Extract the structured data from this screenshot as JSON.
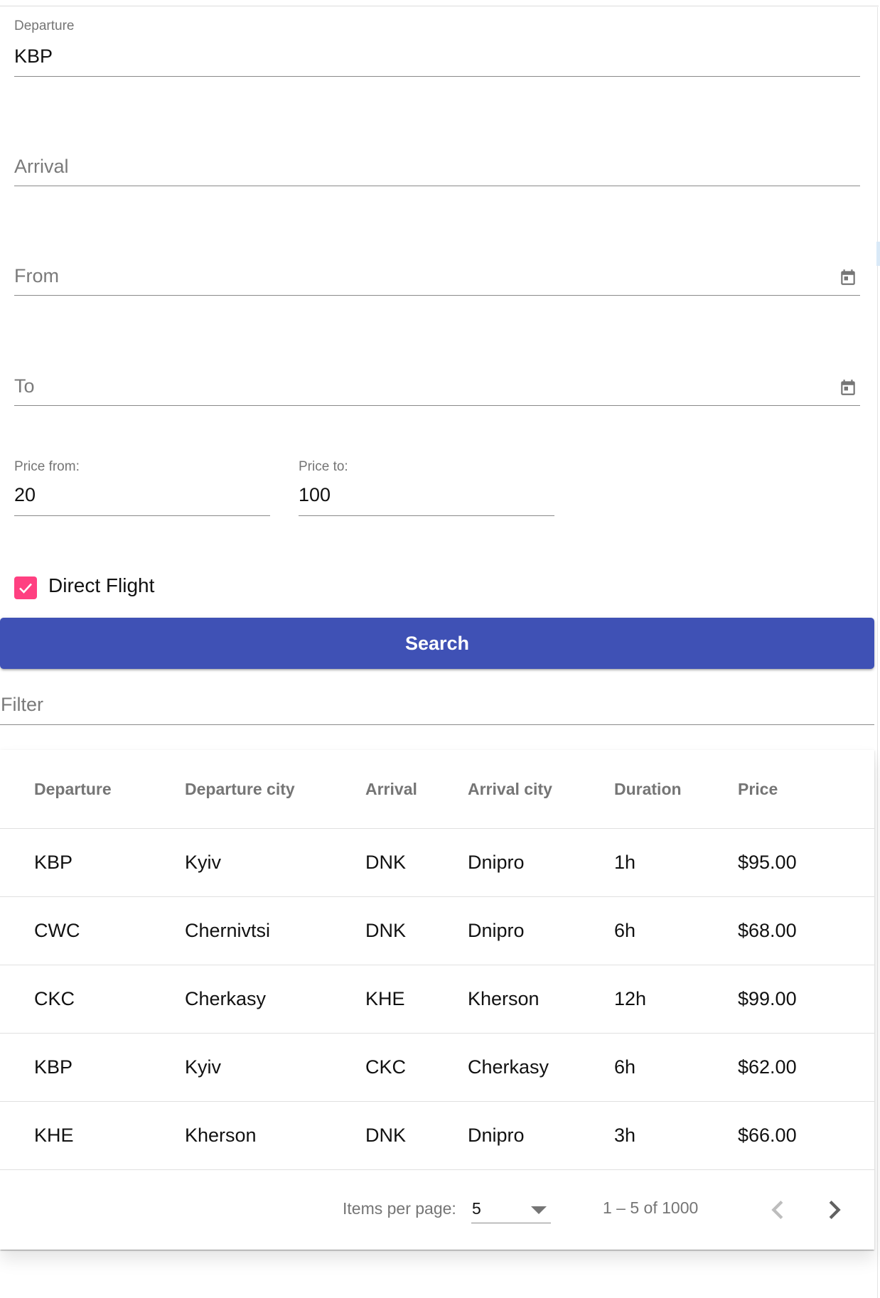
{
  "form": {
    "departure": {
      "label": "Departure",
      "value": "KBP"
    },
    "arrival": {
      "placeholder": "Arrival"
    },
    "from_date": {
      "placeholder": "From",
      "icon": "calendar-icon"
    },
    "to_date": {
      "placeholder": "To",
      "icon": "calendar-icon"
    },
    "price_from": {
      "label": "Price from:",
      "value": "20"
    },
    "price_to": {
      "label": "Price to:",
      "value": "100"
    },
    "direct_flight": {
      "label": "Direct Flight",
      "checked": true
    },
    "search_button": {
      "label": "Search"
    },
    "filter": {
      "placeholder": "Filter"
    }
  },
  "table": {
    "columns": [
      "Departure",
      "Departure city",
      "Arrival",
      "Arrival city",
      "Duration",
      "Price"
    ],
    "rows": [
      [
        "KBP",
        "Kyiv",
        "DNK",
        "Dnipro",
        "1h",
        "$95.00"
      ],
      [
        "CWC",
        "Chernivtsi",
        "DNK",
        "Dnipro",
        "6h",
        "$68.00"
      ],
      [
        "CKC",
        "Cherkasy",
        "KHE",
        "Kherson",
        "12h",
        "$99.00"
      ],
      [
        "KBP",
        "Kyiv",
        "CKC",
        "Cherkasy",
        "6h",
        "$62.00"
      ],
      [
        "KHE",
        "Kherson",
        "DNK",
        "Dnipro",
        "3h",
        "$66.00"
      ]
    ]
  },
  "paginator": {
    "items_per_page_label": "Items per page:",
    "items_per_page": "5",
    "range_label": "1 – 5 of 1000",
    "prev_icon": "chevron-left-icon",
    "next_icon": "chevron-right-icon"
  },
  "colors": {
    "primary": "#3f51b5",
    "accent": "#ff4081"
  }
}
